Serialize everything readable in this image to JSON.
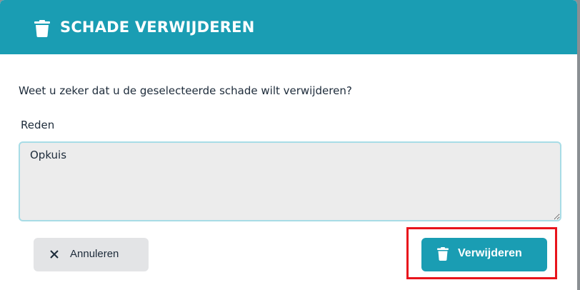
{
  "dialog": {
    "title": "SCHADE VERWIJDEREN",
    "title_icon": "trash-icon",
    "question": "Weet u zeker dat u de geselecteerde schade wilt verwijderen?",
    "reason": {
      "label": "Reden",
      "value": "Opkuis"
    },
    "buttons": {
      "cancel_label": "Annuleren",
      "cancel_icon": "close-icon",
      "delete_label": "Verwijderen",
      "delete_icon": "trash-icon"
    }
  },
  "colors": {
    "accent": "#1a9db3",
    "highlight": "#e8141c",
    "cancel_bg": "#e3e4e6",
    "input_bg": "#ececec"
  }
}
